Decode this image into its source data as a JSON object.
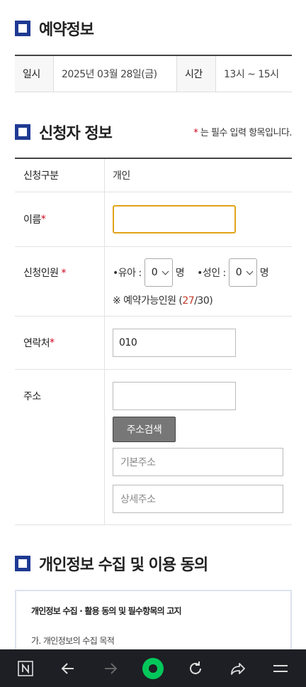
{
  "reservation": {
    "title": "예약정보",
    "date_label": "일시",
    "date_value": "2025년 03월 28일(금)",
    "time_label": "시간",
    "time_value": "13시 ~ 15시"
  },
  "applicant": {
    "title": "신청자 정보",
    "required_star": "*",
    "required_note": " 는 필수 입력 항목입니다.",
    "type_label": "신청구분",
    "type_value": "개인",
    "name_label": "이름 ",
    "count_label": "신청인원 ",
    "infant_label": "•유아 :",
    "infant_value": "0",
    "adult_label": "•성인 :",
    "adult_value": "0",
    "unit": "명",
    "capacity_prefix": "※ 예약가능인원 (",
    "capacity_current": "27",
    "capacity_suffix": "/30)",
    "phone_label": "연락처 ",
    "phone_value": "010",
    "address_label": "주소",
    "address_search_button": "주소검색",
    "address_basic_placeholder": "기본주소",
    "address_detail_placeholder": "상세주소"
  },
  "privacy": {
    "title": "개인정보 수집 및 이용 동의",
    "box_heading": "개인정보 수집 · 활용 동의 및 필수항목의 고지",
    "box_subheading": "가. 개인정보의 수집 목적"
  },
  "colors": {
    "accent_square": "#1f3a93",
    "required_star": "#d0021b",
    "focus_border": "#e0a41a",
    "bottom_bar": "#1d1f24",
    "home_button": "#03c75a"
  },
  "browser_bar": {
    "icons": [
      "naver-n-icon",
      "back-arrow-icon",
      "forward-arrow-icon",
      "home-circle-icon",
      "refresh-icon",
      "share-icon",
      "menu-icon"
    ]
  }
}
